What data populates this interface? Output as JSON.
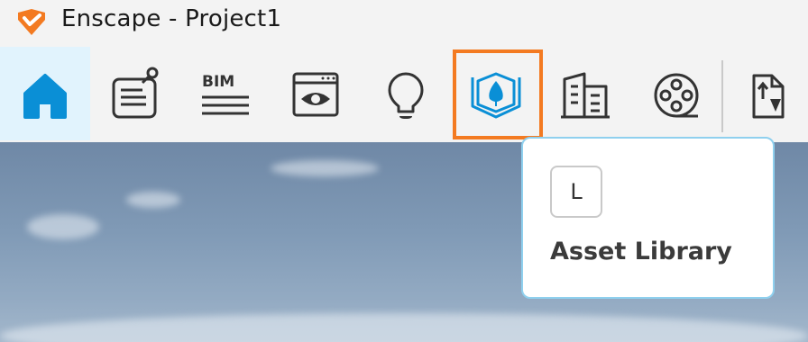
{
  "window": {
    "title": "Enscape - Project1",
    "logo_icon": "enscape-logo-icon",
    "accent_color": "#f37a21"
  },
  "toolbar": {
    "buttons": [
      {
        "icon": "home-icon",
        "active": true
      },
      {
        "icon": "properties-panel-icon"
      },
      {
        "icon": "bim-icon",
        "text": "BIM"
      },
      {
        "icon": "view-window-icon"
      },
      {
        "icon": "lightbulb-icon"
      },
      {
        "icon": "asset-library-icon",
        "highlighted": true
      },
      {
        "icon": "buildings-icon"
      },
      {
        "icon": "film-reel-icon"
      },
      {
        "icon": "export-file-icon"
      }
    ],
    "active_color": "#0a8fd6",
    "highlight_color": "#f37a21"
  },
  "tooltip": {
    "shortcut_key": "L",
    "label": "Asset Library"
  }
}
